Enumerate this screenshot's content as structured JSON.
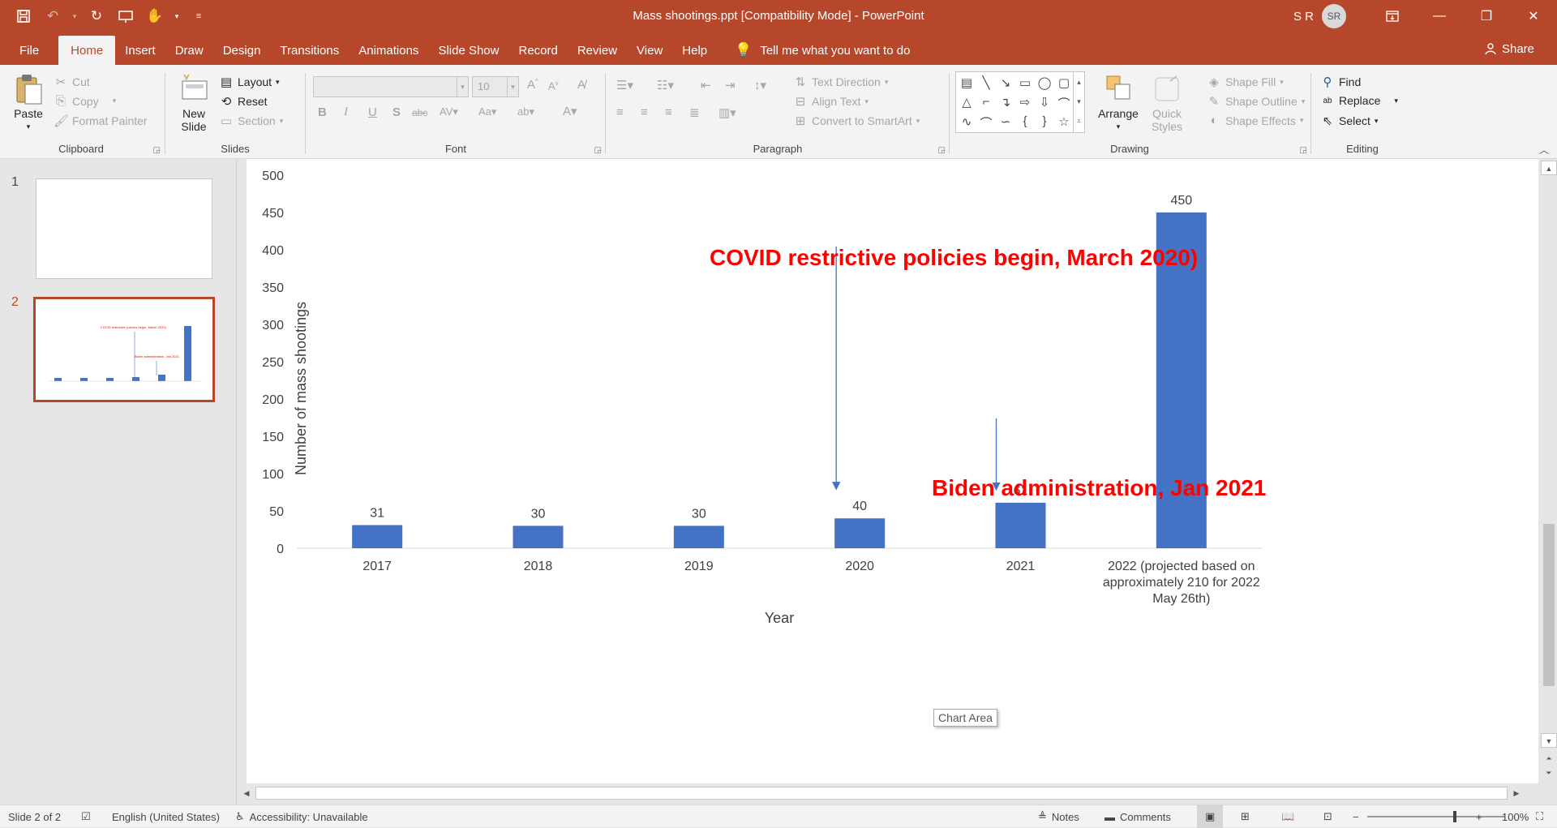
{
  "window": {
    "title": "Mass shootings.ppt [Compatibility Mode]  -  PowerPoint",
    "user_initials": "S R",
    "avatar": "SR"
  },
  "tabs": [
    "File",
    "Home",
    "Insert",
    "Draw",
    "Design",
    "Transitions",
    "Animations",
    "Slide Show",
    "Record",
    "Review",
    "View",
    "Help"
  ],
  "active_tab": "Home",
  "tell_me": "Tell me what you want to do",
  "share": "Share",
  "ribbon": {
    "clipboard": {
      "label": "Clipboard",
      "paste": "Paste",
      "cut": "Cut",
      "copy": "Copy",
      "format_painter": "Format Painter"
    },
    "slides": {
      "label": "Slides",
      "new_slide_1": "New",
      "new_slide_2": "Slide",
      "layout": "Layout",
      "reset": "Reset",
      "section": "Section"
    },
    "font": {
      "label": "Font",
      "font_name": "",
      "font_size": "10"
    },
    "paragraph": {
      "label": "Paragraph",
      "text_direction": "Text Direction",
      "align_text": "Align Text",
      "convert_smartart": "Convert to SmartArt"
    },
    "drawing": {
      "label": "Drawing",
      "arrange": "Arrange",
      "quick_styles_1": "Quick",
      "quick_styles_2": "Styles",
      "shape_fill": "Shape Fill",
      "shape_outline": "Shape Outline",
      "shape_effects": "Shape Effects"
    },
    "editing": {
      "label": "Editing",
      "find": "Find",
      "replace": "Replace",
      "select": "Select"
    }
  },
  "thumbnails": [
    {
      "number": "1"
    },
    {
      "number": "2"
    }
  ],
  "tooltip": "Chart Area",
  "annotations": {
    "covid": "COVID restrictive policies begin, March 2020)",
    "biden": "Biden administration, Jan 2021"
  },
  "chart_data": {
    "type": "bar",
    "categories": [
      "2017",
      "2018",
      "2019",
      "2020",
      "2021",
      "2022 (projected based on approximately 210 for 2022 May 26th)"
    ],
    "category_lines": [
      [
        "2017"
      ],
      [
        "2018"
      ],
      [
        "2019"
      ],
      [
        "2020"
      ],
      [
        "2021"
      ],
      [
        "2022 (projected based on",
        "approximately 210 for 2022",
        "May 26th)"
      ]
    ],
    "values": [
      31,
      30,
      30,
      40,
      61,
      450
    ],
    "data_labels": [
      "31",
      "30",
      "30",
      "40",
      "61",
      "450"
    ],
    "xlabel": "Year",
    "ylabel": "Number of mass shootings",
    "ylim": [
      0,
      500
    ],
    "yticks": [
      0,
      50,
      100,
      150,
      200,
      250,
      300,
      350,
      400,
      450,
      500
    ],
    "bar_color": "#4472c4",
    "annotation_color": "#ff0000",
    "grid": false,
    "legend": false
  },
  "status": {
    "slide_info": "Slide 2 of 2",
    "language": "English (United States)",
    "accessibility": "Accessibility: Unavailable",
    "notes": "Notes",
    "comments": "Comments",
    "zoom": "100%"
  },
  "colors": {
    "accent": "#b7472a",
    "ribbon_bg": "#f3f3f3"
  }
}
